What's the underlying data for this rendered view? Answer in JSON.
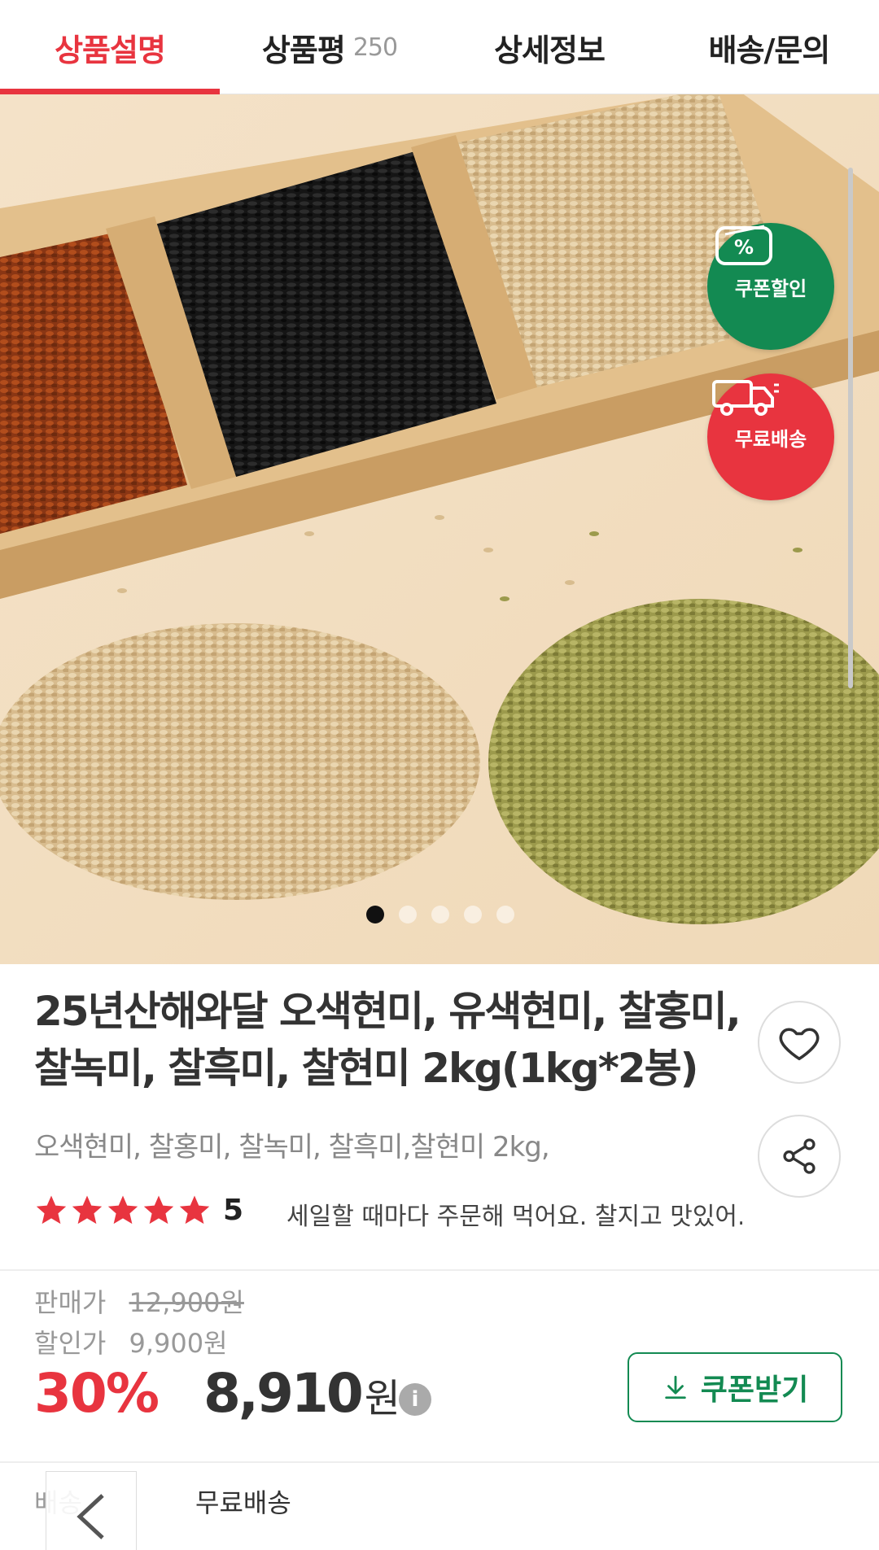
{
  "tabs": [
    {
      "label": "상품설명",
      "count": ""
    },
    {
      "label": "상품평",
      "count": "250"
    },
    {
      "label": "상세정보",
      "count": ""
    },
    {
      "label": "배송/문의",
      "count": ""
    }
  ],
  "badges": {
    "coupon": {
      "icon_text": "%",
      "label": "쿠폰할인",
      "color": "#138a52"
    },
    "free_shipping": {
      "label": "무료배송",
      "color": "#e8343f"
    }
  },
  "carousel": {
    "current": 1,
    "total": 5
  },
  "product": {
    "title": "25년산해와달 오색현미, 유색현미, 찰홍미, 찰녹미, 찰흑미, 찰현미 2kg(1kg*2봉)",
    "subtitle": "오색현미, 찰홍미, 찰녹미, 찰흑미,찰현미 2kg,",
    "rating": 5,
    "rating_text": "5",
    "review_snippet": "세일할 때마다 주문해 먹어요. 찰지고 맛있어."
  },
  "price": {
    "sale_label": "판매가",
    "sale_value": "12,900원",
    "discount_label": "할인가",
    "discount_value": "9,900원",
    "discount_rate": "30%",
    "final_value": "8,910",
    "final_unit": "원",
    "info_icon": "i"
  },
  "coupon_button": {
    "label": "쿠폰받기"
  },
  "shipping": {
    "label": "배송",
    "value": "무료배송"
  },
  "colors": {
    "accent": "#e8343f",
    "green": "#138a52"
  }
}
